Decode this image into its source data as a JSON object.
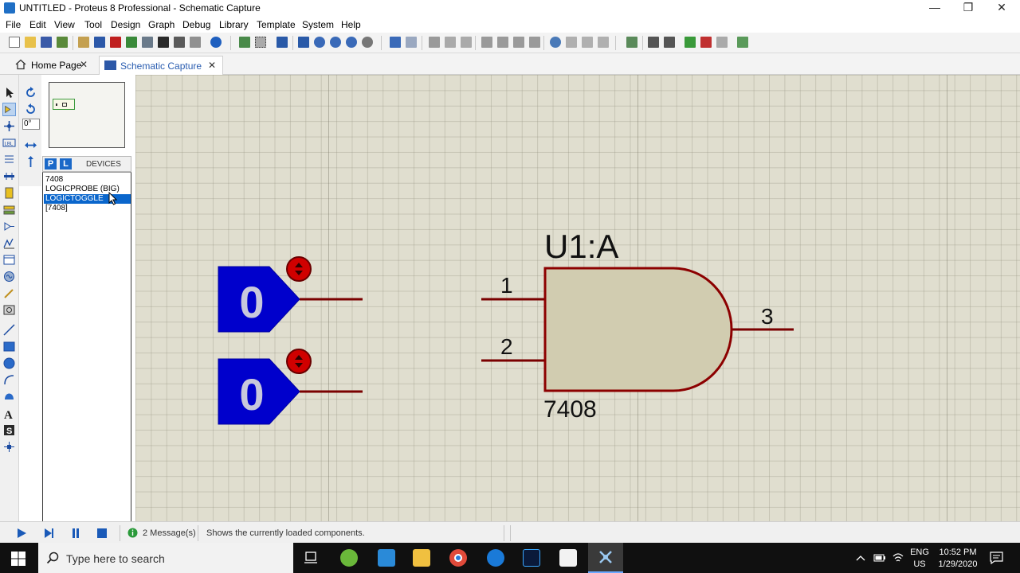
{
  "window": {
    "title": "UNTITLED - Proteus 8 Professional - Schematic Capture",
    "minimize": "—",
    "restore": "❐",
    "close": "✕"
  },
  "menu": {
    "items": [
      {
        "label": "File"
      },
      {
        "label": "Edit"
      },
      {
        "label": "View"
      },
      {
        "label": "Tool"
      },
      {
        "label": "Design"
      },
      {
        "label": "Graph"
      },
      {
        "label": "Debug"
      },
      {
        "label": "Library"
      },
      {
        "label": "Template"
      },
      {
        "label": "System"
      },
      {
        "label": "Help"
      }
    ]
  },
  "tabs": [
    {
      "label": "Home Page",
      "close": "✕",
      "icon": "home-icon"
    },
    {
      "label": "Schematic Capture",
      "close": "✕",
      "icon": "schematic-icon",
      "active": true
    }
  ],
  "rotate": {
    "angle_value": "0°"
  },
  "devices": {
    "p_button": "P",
    "l_button": "L",
    "header": "DEVICES",
    "items": [
      "7408",
      "LOGICPROBE (BIG)",
      "LOGICTOGGLE",
      "[7408]"
    ],
    "selected_index": 2
  },
  "schematic": {
    "toggle_1_value": "0",
    "toggle_2_value": "0",
    "gate_ref": "U1:A",
    "gate_type": "7408",
    "pin_1": "1",
    "pin_2": "2",
    "pin_3": "3",
    "colors": {
      "toggle_fill": "#0000cc",
      "wire": "#7a0000",
      "gate_fill": "#d1ccb0",
      "gate_stroke": "#8c0000",
      "indicator": "#d00000"
    }
  },
  "status": {
    "play_icon": "play-icon",
    "step_icon": "step-icon",
    "pause_icon": "pause-icon",
    "stop_icon": "stop-icon",
    "messages": "2 Message(s)",
    "hint": "Shows the currently loaded components."
  },
  "taskbar": {
    "search_placeholder": "Type here to search",
    "lang_1": "ENG",
    "lang_2": "US",
    "time": "10:52 PM",
    "date": "1/29/2020"
  }
}
